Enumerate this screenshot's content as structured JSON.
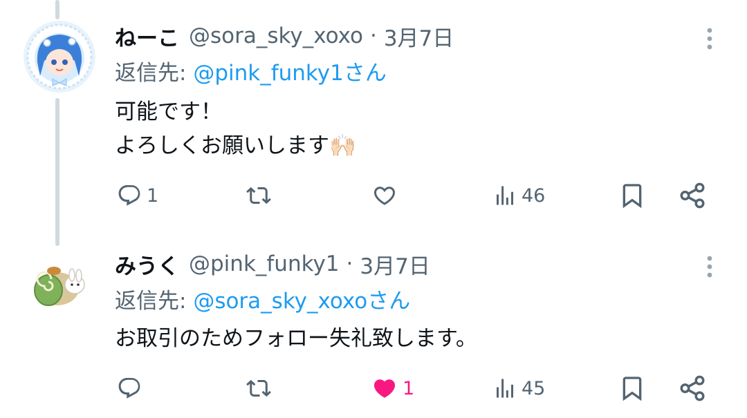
{
  "tweets": [
    {
      "name": "ねーこ",
      "handle": "@sora_sky_xoxo",
      "dot": "·",
      "date": "3月7日",
      "reply_label": "返信先:",
      "reply_mention": "@pink_funky1さん",
      "lines": [
        "可能です！",
        "よろしくお願いします🙌🏻"
      ],
      "actions": {
        "reply_count": "1",
        "retweet_count": "",
        "like_count": "",
        "liked": false,
        "views_count": "46"
      }
    },
    {
      "name": "みうく",
      "handle": "@pink_funky1",
      "dot": "·",
      "date": "3月7日",
      "reply_label": "返信先:",
      "reply_mention": "@sora_sky_xoxoさん",
      "lines": [
        "お取引のためフォロー失礼致します。"
      ],
      "actions": {
        "reply_count": "",
        "retweet_count": "",
        "like_count": "1",
        "liked": true,
        "views_count": "45"
      }
    }
  ],
  "colors": {
    "accent": "#1d9bf0",
    "secondary_text": "#536471",
    "like": "#f91880",
    "thread_line": "#cfd9de"
  },
  "icons": {
    "reply": "reply-icon",
    "retweet": "retweet-icon",
    "like": "heart-icon",
    "views": "views-icon",
    "bookmark": "bookmark-icon",
    "share": "share-icon",
    "more": "more-vertical-icon"
  }
}
